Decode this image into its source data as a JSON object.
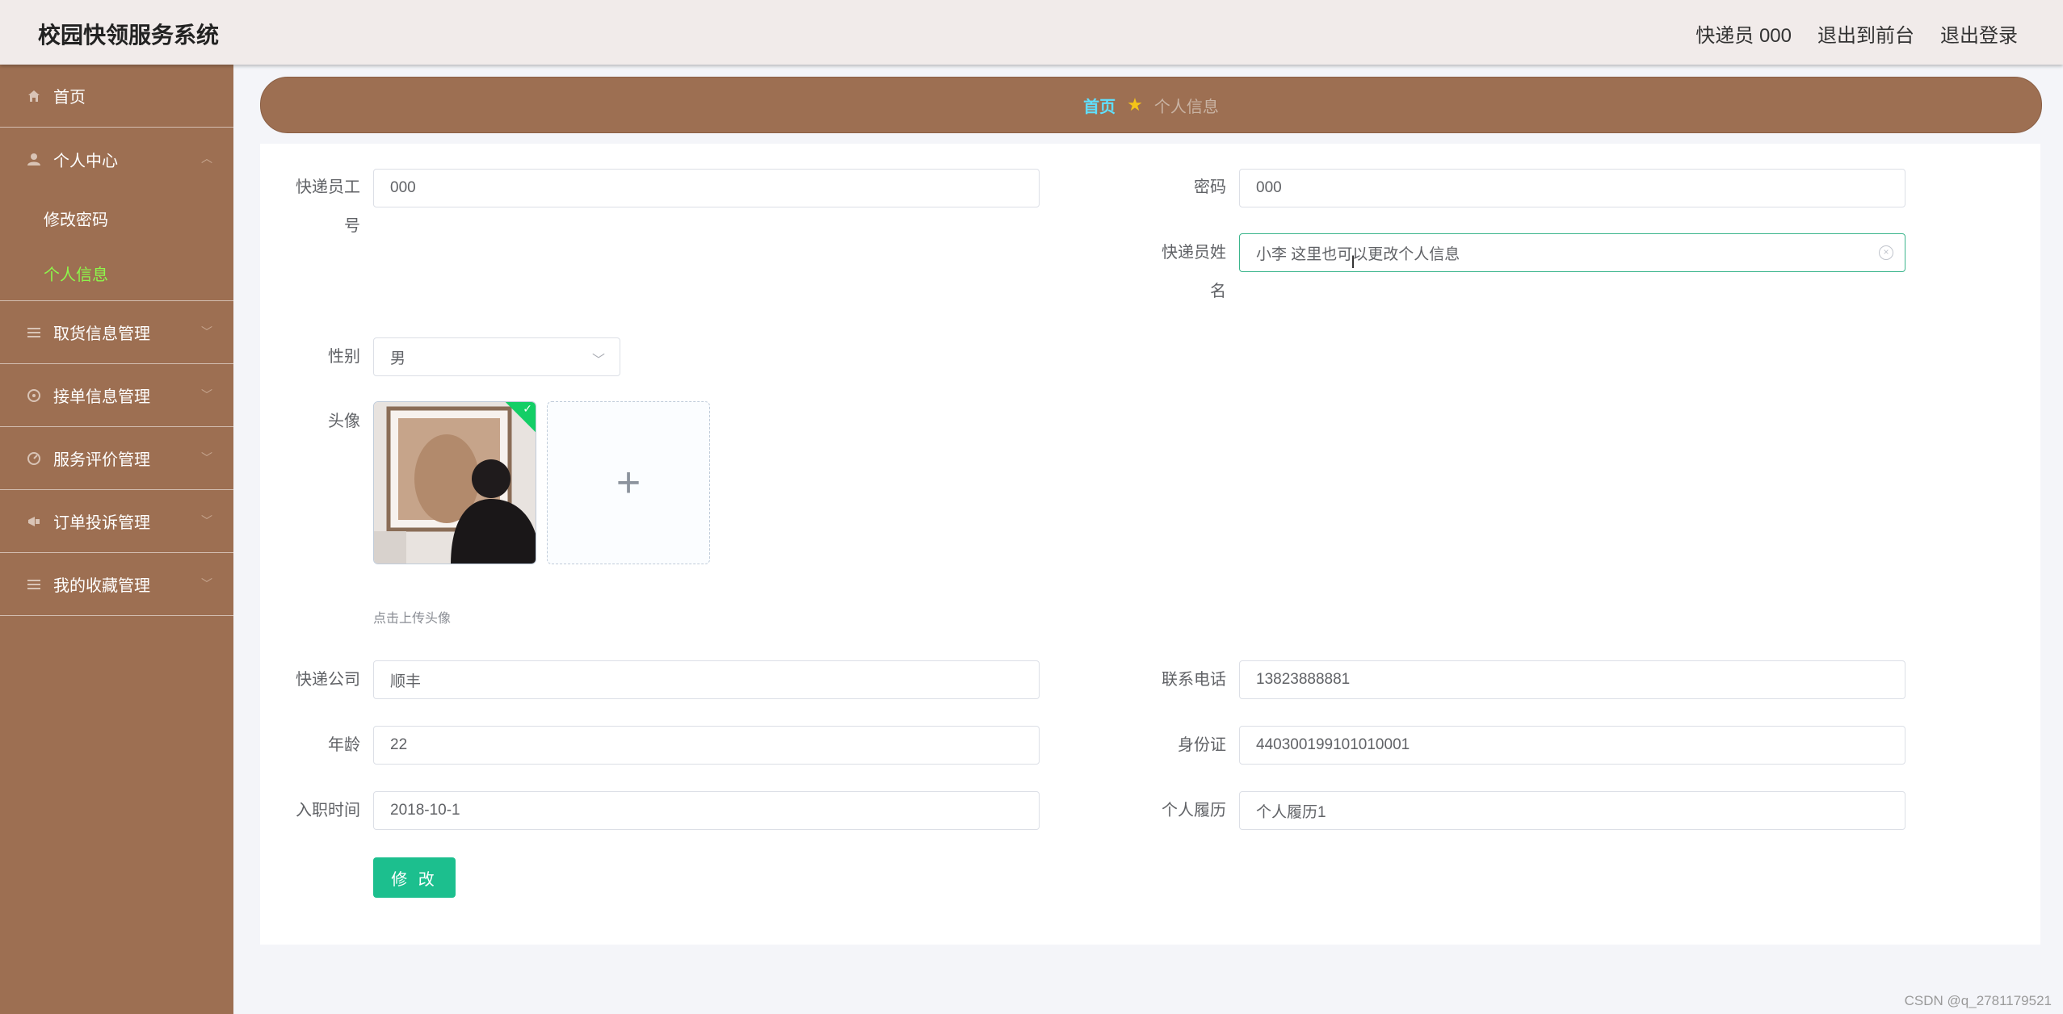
{
  "header": {
    "title": "校园快领服务系统",
    "user_label": "快递员 000",
    "to_front_label": "退出到前台",
    "logout_label": "退出登录"
  },
  "sidebar": {
    "items": [
      {
        "label": "首页",
        "icon": "home-icon"
      },
      {
        "label": "个人中心",
        "icon": "user-icon",
        "expanded": true,
        "children": [
          {
            "label": "修改密码"
          },
          {
            "label": "个人信息",
            "active": true
          }
        ]
      },
      {
        "label": "取货信息管理",
        "icon": "list-icon"
      },
      {
        "label": "接单信息管理",
        "icon": "target-icon"
      },
      {
        "label": "服务评价管理",
        "icon": "gauge-icon"
      },
      {
        "label": "订单投诉管理",
        "icon": "megaphone-icon"
      },
      {
        "label": "我的收藏管理",
        "icon": "list-icon"
      }
    ]
  },
  "breadcrumb": {
    "home": "首页",
    "current": "个人信息"
  },
  "form": {
    "courier_no_label_1": "快递员工",
    "courier_no_label_2": "号",
    "courier_no": "000",
    "password_label": "密码",
    "password": "000",
    "name_label_1": "快递员姓",
    "name_label_2": "名",
    "name": "小李  这里也可以更改个人信息",
    "gender_label": "性别",
    "gender": "男",
    "avatar_label": "头像",
    "upload_tip": "点击上传头像",
    "company_label": "快递公司",
    "company": "顺丰",
    "phone_label": "联系电话",
    "phone": "13823888881",
    "age_label": "年龄",
    "age": "22",
    "id_label": "身份证",
    "id_card": "440300199101010001",
    "join_label": "入职时间",
    "join_date": "2018-10-1",
    "resume_label": "个人履历",
    "resume": "个人履历1",
    "submit_label": "修 改"
  },
  "watermark": "CSDN @q_2781179521",
  "colors": {
    "sidebar": "#9d6f52",
    "active_menu": "#8df74b",
    "primary": "#1cbf8e",
    "breadcrumb_home": "#5fe0ff"
  }
}
